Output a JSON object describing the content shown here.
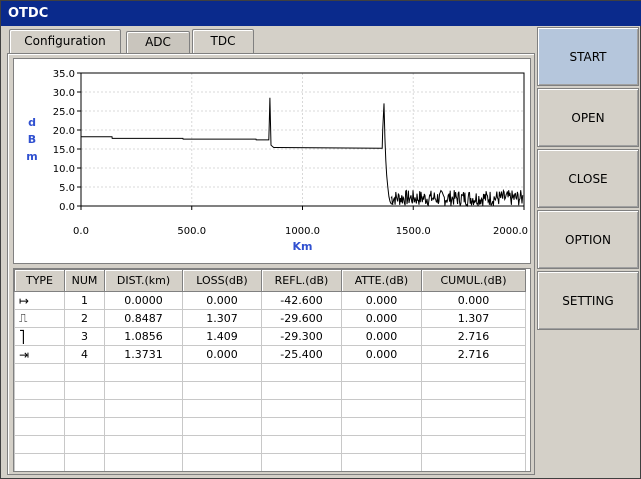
{
  "window": {
    "title": "OTDC"
  },
  "tabs": [
    {
      "label": "Configuration"
    },
    {
      "label": "ADC"
    },
    {
      "label": "TDC"
    }
  ],
  "side_buttons": [
    {
      "label": "START"
    },
    {
      "label": "OPEN"
    },
    {
      "label": "CLOSE"
    },
    {
      "label": "OPTION"
    },
    {
      "label": "SETTING"
    }
  ],
  "chart_data": {
    "type": "line",
    "xlabel": "Km",
    "ylabel": "dBm",
    "xlim": [
      0,
      2000
    ],
    "ylim": [
      0,
      35
    ],
    "x_ticks": [
      "0.0",
      "500.0",
      "1000.0",
      "1500.0",
      "2000.0"
    ],
    "y_ticks": [
      "35.0",
      "30.0",
      "25.0",
      "20.0",
      "15.0",
      "10.0",
      "5.0",
      "0.0"
    ],
    "grid": true,
    "series": [
      {
        "x": [
          0,
          140,
          141,
          460,
          461,
          790,
          791,
          848,
          850,
          853,
          858,
          870,
          880,
          1360,
          1362,
          1368,
          1372,
          1376,
          1380,
          1385,
          1390,
          1395,
          1400,
          1410
        ],
        "values": [
          18.2,
          18.2,
          17.8,
          17.8,
          17.6,
          17.6,
          17.4,
          17.4,
          22,
          28.5,
          16,
          15.4,
          15.4,
          15.2,
          20,
          27,
          18,
          12,
          8,
          5,
          2.5,
          1.2,
          0.6,
          0.4
        ]
      }
    ],
    "noise_region": {
      "x_start": 1400,
      "x_end": 1995,
      "min": 0.0,
      "max": 4.2
    }
  },
  "event_table": {
    "columns": [
      "TYPE",
      "NUM",
      "DIST.(km)",
      "LOSS(dB)",
      "REFL.(dB)",
      "ATTE.(dB)",
      "CUMUL.(dB)"
    ],
    "rows": [
      {
        "type_icon": "↦",
        "num": "1",
        "dist": "0.0000",
        "loss": "0.000",
        "refl": "-42.600",
        "atte": "0.000",
        "cumul": "0.000"
      },
      {
        "type_icon": "⎍",
        "num": "2",
        "dist": "0.8487",
        "loss": "1.307",
        "refl": "-29.600",
        "atte": "0.000",
        "cumul": "1.307"
      },
      {
        "type_icon": "⎤",
        "num": "3",
        "dist": "1.0856",
        "loss": "1.409",
        "refl": "-29.300",
        "atte": "0.000",
        "cumul": "2.716"
      },
      {
        "type_icon": "⇥",
        "num": "4",
        "dist": "1.3731",
        "loss": "0.000",
        "refl": "-25.400",
        "atte": "0.000",
        "cumul": "2.716"
      }
    ],
    "empty_rows": 6
  }
}
